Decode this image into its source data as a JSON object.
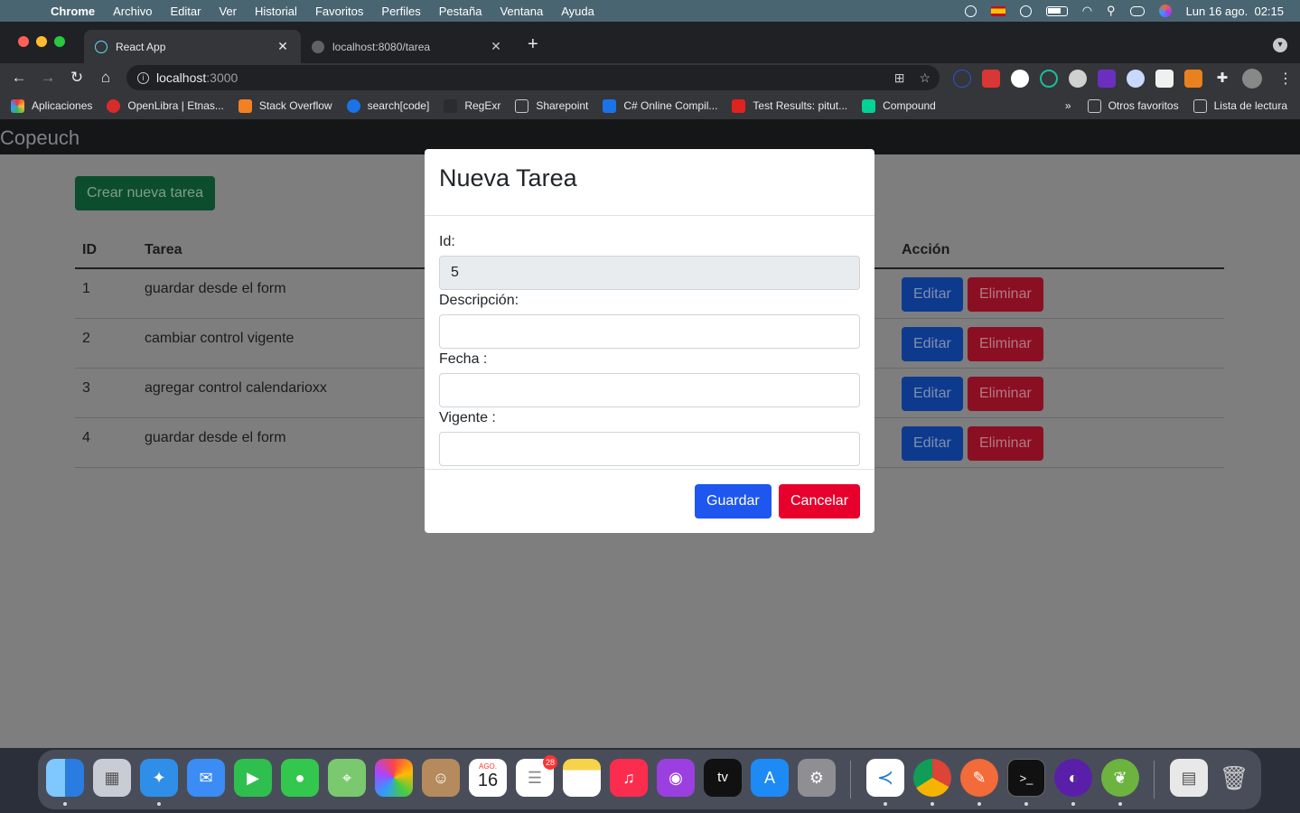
{
  "menubar": {
    "app": "Chrome",
    "items": [
      "Archivo",
      "Editar",
      "Ver",
      "Historial",
      "Favoritos",
      "Perfiles",
      "Pestaña",
      "Ventana",
      "Ayuda"
    ],
    "clock": "Lun 16 ago.  02:15"
  },
  "tabs": [
    {
      "title": "React App"
    },
    {
      "title": "localhost:8080/tarea"
    }
  ],
  "omnibox": {
    "host": "localhost",
    "port": ":3000"
  },
  "bookmarks": {
    "items": [
      "Aplicaciones",
      "OpenLibra | Etnas...",
      "Stack Overflow",
      "search[code]",
      "RegExr",
      "Sharepoint",
      "C# Online Compil...",
      "Test Results: pitut...",
      "Compound"
    ],
    "overflow": "»",
    "other": "Otros favoritos",
    "reading_list": "Lista de lectura"
  },
  "page": {
    "brand": "Copeuch",
    "create_label": "Crear nueva tarea",
    "columns": {
      "id": "ID",
      "task": "Tarea",
      "action": "Acción"
    },
    "rows": [
      {
        "id": "1",
        "task": "guardar desde el form"
      },
      {
        "id": "2",
        "task": "cambiar control vigente"
      },
      {
        "id": "3",
        "task": "agregar control calendarioxx"
      },
      {
        "id": "4",
        "task": "guardar desde el form"
      }
    ],
    "edit_label": "Editar",
    "delete_label": "Eliminar"
  },
  "modal": {
    "title": "Nueva Tarea",
    "id_label": "Id:",
    "id_value": "5",
    "desc_label": "Descripción:",
    "desc_value": "",
    "date_label": "Fecha :",
    "date_value": "",
    "active_label": "Vigente :",
    "active_value": "",
    "save_label": "Guardar",
    "cancel_label": "Cancelar"
  },
  "dock": {
    "calendar_month": "AGO.",
    "calendar_day": "16",
    "reminders_badge": "28",
    "tv_label": "tv"
  },
  "colors": {
    "save": "#1e56f0",
    "cancel": "#e8002d",
    "create": "#198754",
    "edit": "#0d6efd",
    "delete": "#dc3545"
  }
}
